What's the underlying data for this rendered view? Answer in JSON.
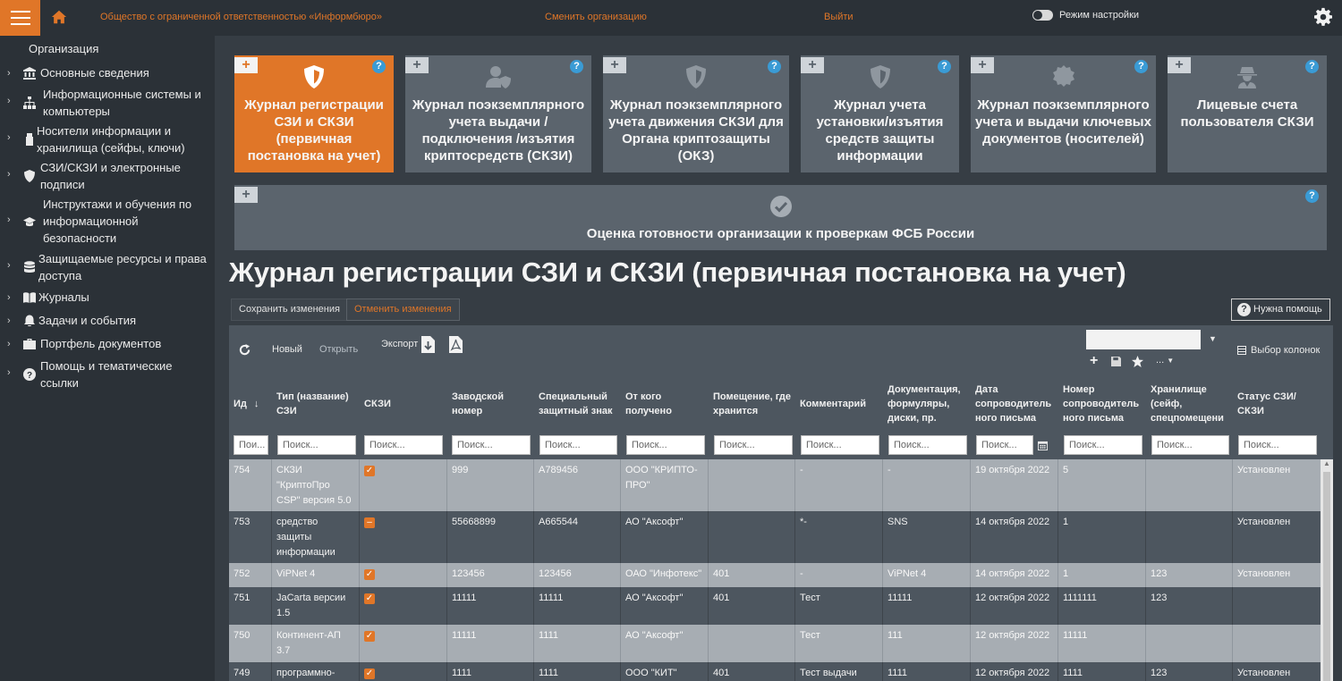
{
  "topbar": {
    "org_name": "Общество с ограниченной ответственностью «Информбюро»",
    "change_org": "Сменить организацию",
    "logout": "Выйти",
    "settings_mode": "Режим настройки"
  },
  "sidebar": {
    "title": "Организация",
    "items": [
      {
        "label": "Основные сведения",
        "icon": "bank-icon"
      },
      {
        "label": "Информационные системы и компьютеры",
        "icon": "network-icon"
      },
      {
        "label": "Носители информации и хранилища (сейфы, ключи)",
        "icon": "usb-drive-icon"
      },
      {
        "label": "СЗИ/СКЗИ и электронные подписи",
        "icon": "shield-icon"
      },
      {
        "label": "Инструктажи и обучения по информационной безопасности",
        "icon": "graduation-cap-icon"
      },
      {
        "label": "Защищаемые ресурсы и права доступа",
        "icon": "database-icon"
      },
      {
        "label": "Журналы",
        "icon": "book-icon"
      },
      {
        "label": "Задачи и события",
        "icon": "bell-icon"
      },
      {
        "label": "Портфель документов",
        "icon": "briefcase-icon"
      },
      {
        "label": "Помощь и тематические ссылки",
        "icon": "question-icon"
      }
    ]
  },
  "tiles": [
    {
      "title": "Журнал регистрации СЗИ и СКЗИ (первичная постановка на учет)",
      "icon": "shield-icon",
      "active": true
    },
    {
      "title": "Журнал поэкземплярного учета выдачи / подключения /изъятия криптосредств (СКЗИ)",
      "icon": "user-shield-icon"
    },
    {
      "title": "Журнал поэкземплярного учета движения СКЗИ для Органа криптозащиты (ОКЗ)",
      "icon": "shield-icon"
    },
    {
      "title": "Журнал учета установки/изъятия средств защиты информации",
      "icon": "shield-icon"
    },
    {
      "title": "Журнал поэкземплярного учета и выдачи ключевых документов (носителей)",
      "icon": "certificate-icon"
    },
    {
      "title": "Лицевые счета пользователя СКЗИ",
      "icon": "user-secret-icon"
    }
  ],
  "wide_tile": {
    "title": "Оценка готовности организации к проверкам ФСБ России",
    "icon": "check-circle-icon"
  },
  "page_title": "Журнал регистрации СЗИ и СКЗИ (первичная постановка на учет)",
  "buttons": {
    "save": "Сохранить изменения",
    "cancel": "Отменить изменения",
    "help": "Нужна помощь"
  },
  "toolbar": {
    "new": "Новый",
    "open": "Открыть",
    "export": "Экспорт",
    "columns": "Выбор колонок",
    "more": "..."
  },
  "columns": [
    "Ид",
    "Тип (название) СЗИ",
    "СКЗИ",
    "Заводской номер",
    "Специальный защитный знак",
    "От кого получено",
    "Помещение, где хранится",
    "Комментарий",
    "Документация, формуляры, диски, пр.",
    "Дата сопроводитель ного письма",
    "Номер сопроводитель ного письма",
    "Хранилище (сейф, спецпомещени",
    "Статус СЗИ/ СКЗИ"
  ],
  "filter_placeholders": [
    "Пои...",
    "Поиск...",
    "Поиск...",
    "Поиск...",
    "Поиск...",
    "Поиск...",
    "Поиск...",
    "Поиск...",
    "Поиск...",
    "Поиск...",
    "Поиск...",
    "Поиск...",
    "Поиск..."
  ],
  "rows": [
    {
      "id": "754",
      "type": "СКЗИ \"КриптоПро CSP\" версия 5.0",
      "skzi": "check",
      "serial": "999",
      "mark": "А789456",
      "from": "ООО \"КРИПТО-ПРО\"",
      "room": "",
      "comment": "-",
      "docs": "-",
      "date": "19 октября 2022",
      "num": "5",
      "storage": "",
      "status": "Установлен"
    },
    {
      "id": "753",
      "type": "средство защиты информации Secret Net Studio",
      "skzi": "minus",
      "serial": "55668899",
      "mark": "А665544",
      "from": "АО \"Аксофт\"",
      "room": "",
      "comment": "*-",
      "docs": "SNS",
      "date": "14 октября 2022",
      "num": "1",
      "storage": "",
      "status": "Установлен"
    },
    {
      "id": "752",
      "type": "ViPNet 4",
      "skzi": "check",
      "serial": "123456",
      "mark": "123456",
      "from": "ОАО \"Инфотекс\"",
      "room": "401",
      "comment": "-",
      "docs": "ViPNet 4",
      "date": "14 октября 2022",
      "num": "1",
      "storage": "123",
      "status": "Установлен"
    },
    {
      "id": "751",
      "type": "JaCarta версии 1.5",
      "skzi": "check",
      "serial": "11111",
      "mark": "11111",
      "from": "АО \"Аксофт\"",
      "room": "401",
      "comment": "Тест",
      "docs": "11111",
      "date": "12 октября 2022",
      "num": "1111111",
      "storage": "123",
      "status": ""
    },
    {
      "id": "750",
      "type": "Континент-АП 3.7",
      "skzi": "check",
      "serial": "11111",
      "mark": "1111",
      "from": "АО \"Аксофт\"",
      "room": "",
      "comment": "Тест",
      "docs": "111",
      "date": "12 октября 2022",
      "num": "11111",
      "storage": "",
      "status": ""
    },
    {
      "id": "749",
      "type": "программно-",
      "skzi": "check",
      "serial": "1111",
      "mark": "1111",
      "from": "ООО \"КИТ\"",
      "room": "401",
      "comment": "Тест выдачи",
      "docs": "1111",
      "date": "12 октября 2022",
      "num": "1111",
      "storage": "123",
      "status": "Установлен"
    }
  ],
  "colors": {
    "accent": "#e07628",
    "tile": "#5b646d",
    "bg": "#363d44",
    "row_light": "#a7adb3",
    "row_dark": "#4d565f"
  }
}
